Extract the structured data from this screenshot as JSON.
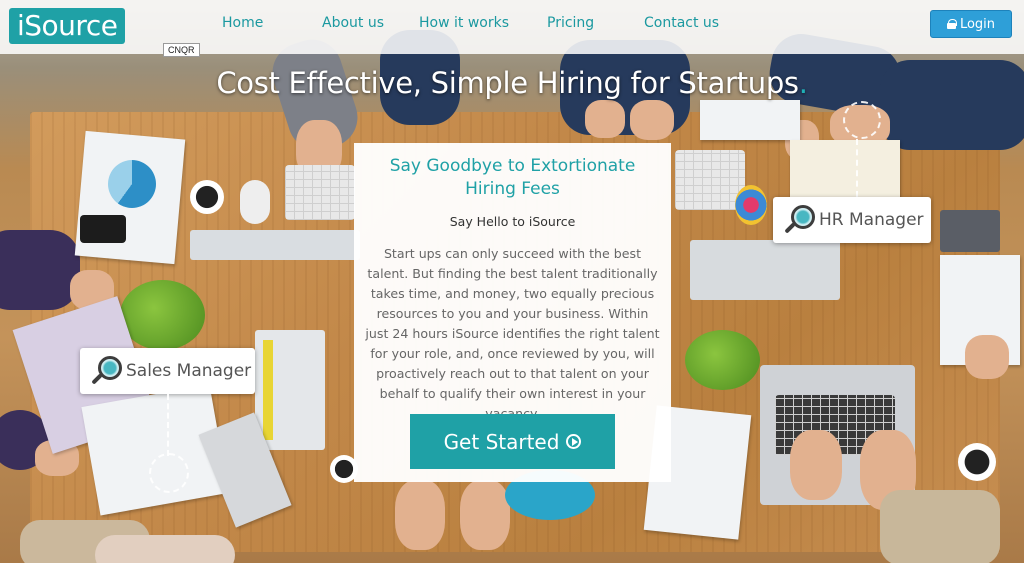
{
  "header": {
    "logo_text": "iSource",
    "nav": [
      {
        "label": "Home"
      },
      {
        "label": "About us"
      },
      {
        "label": "How it works"
      },
      {
        "label": "Pricing"
      },
      {
        "label": "Contact us"
      }
    ],
    "login_label": "Login",
    "tag_label": "CNQR"
  },
  "hero": {
    "headline": "Cost Effective, Simple Hiring for Startups",
    "headline_dot": "."
  },
  "card": {
    "title": "Say Goodbye to Extortionate Hiring Fees",
    "subtitle": "Say Hello to iSource",
    "body": "Start ups can only succeed with the best talent. But finding the best talent traditionally takes time, and money, two equally precious resources to you and your business. Within just 24 hours iSource identifies the right talent for your role, and, once reviewed by you, will proactively reach out to that talent on your behalf to qualify their own interest in your vacancy.",
    "cta_label": "Get Started"
  },
  "chips": {
    "hr": "HR Manager",
    "sales": "Sales Manager"
  },
  "colors": {
    "accent": "#1fa1a6",
    "login": "#2e9fd8"
  },
  "icons": [
    "lock-icon",
    "play-circle-icon",
    "magnifier-icon"
  ]
}
